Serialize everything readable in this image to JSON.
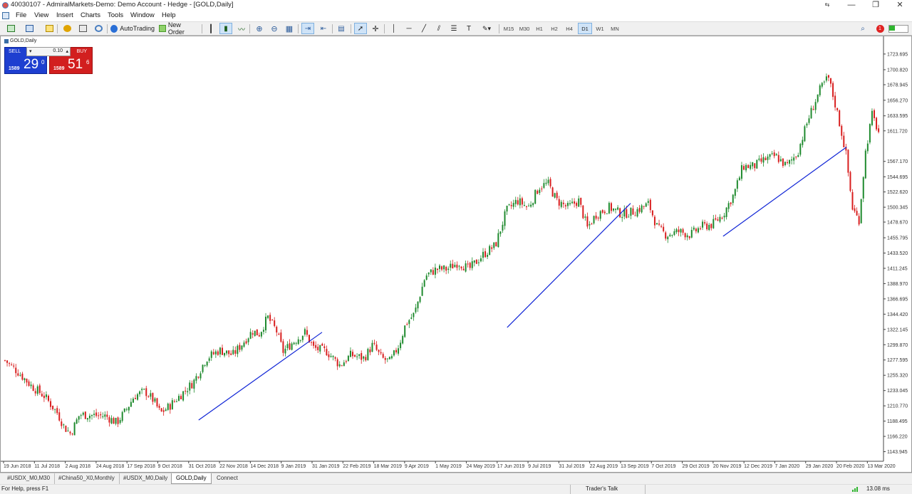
{
  "window": {
    "title": "40030107 - AdmiralMarkets-Demo: Demo Account - Hedge - [GOLD,Daily]"
  },
  "menu": [
    "File",
    "View",
    "Insert",
    "Charts",
    "Tools",
    "Window",
    "Help"
  ],
  "toolbar": {
    "autotrading_label": "AutoTrading",
    "neworder_label": "New Order",
    "timeframes": [
      "M15",
      "M30",
      "H1",
      "H2",
      "H4",
      "D1",
      "W1",
      "MN"
    ],
    "active_timeframe": "D1",
    "notification_count": "1"
  },
  "chart": {
    "symbol_label": "GOLD,Daily",
    "trade_panel": {
      "sell_label": "SELL",
      "buy_label": "BUY",
      "lot": "0.10",
      "sell_prefix": "1589",
      "sell_main": "29",
      "sell_sup": "0",
      "buy_prefix": "1589",
      "buy_main": "51",
      "buy_sup": "6"
    }
  },
  "chart_data": {
    "type": "candlestick",
    "symbol": "GOLD",
    "timeframe": "Daily",
    "price_labels": [
      "1723.695",
      "1700.820",
      "1678.945",
      "1656.270",
      "1633.595",
      "1611.720",
      "1567.170",
      "1544.695",
      "1522.620",
      "1500.345",
      "1478.670",
      "1455.795",
      "1433.520",
      "1411.245",
      "1388.970",
      "1366.695",
      "1344.420",
      "1322.145",
      "1299.870",
      "1277.595",
      "1255.320",
      "1233.045",
      "1210.770",
      "1188.495",
      "1166.220",
      "1143.945"
    ],
    "ylim": [
      1131,
      1735
    ],
    "date_labels": [
      "19 Jun 2018",
      "11 Jul 2018",
      "2 Aug 2018",
      "24 Aug 2018",
      "17 Sep 2018",
      "9 Oct 2018",
      "31 Oct 2018",
      "22 Nov 2018",
      "14 Dec 2018",
      "9 Jan 2019",
      "31 Jan 2019",
      "22 Feb 2019",
      "18 Mar 2019",
      "9 Apr 2019",
      "1 May 2019",
      "24 May 2019",
      "17 Jun 2019",
      "9 Jul 2019",
      "31 Jul 2019",
      "22 Aug 2019",
      "13 Sep 2019",
      "7 Oct 2019",
      "29 Oct 2019",
      "20 Nov 2019",
      "12 Dec 2019",
      "7 Jan 2020",
      "29 Jan 2020",
      "20 Feb 2020",
      "13 Mar 2020"
    ],
    "close_path": [
      [
        0,
        1277
      ],
      [
        6,
        1260
      ],
      [
        12,
        1240
      ],
      [
        18,
        1225
      ],
      [
        24,
        1200
      ],
      [
        27,
        1180
      ],
      [
        30,
        1170
      ],
      [
        34,
        1198
      ],
      [
        40,
        1197
      ],
      [
        46,
        1196
      ],
      [
        51,
        1186
      ],
      [
        55,
        1203
      ],
      [
        59,
        1225
      ],
      [
        64,
        1232
      ],
      [
        68,
        1218
      ],
      [
        71,
        1200
      ],
      [
        75,
        1210
      ],
      [
        80,
        1226
      ],
      [
        86,
        1245
      ],
      [
        92,
        1280
      ],
      [
        98,
        1292
      ],
      [
        104,
        1285
      ],
      [
        108,
        1300
      ],
      [
        113,
        1320
      ],
      [
        116,
        1315
      ],
      [
        120,
        1340
      ],
      [
        124,
        1320
      ],
      [
        127,
        1290
      ],
      [
        131,
        1302
      ],
      [
        137,
        1318
      ],
      [
        141,
        1295
      ],
      [
        147,
        1290
      ],
      [
        153,
        1270
      ],
      [
        158,
        1285
      ],
      [
        164,
        1280
      ],
      [
        168,
        1300
      ],
      [
        172,
        1280
      ],
      [
        176,
        1275
      ],
      [
        180,
        1300
      ],
      [
        183,
        1330
      ],
      [
        187,
        1345
      ],
      [
        192,
        1400
      ],
      [
        197,
        1410
      ],
      [
        202,
        1410
      ],
      [
        207,
        1420
      ],
      [
        212,
        1410
      ],
      [
        218,
        1430
      ],
      [
        224,
        1445
      ],
      [
        229,
        1495
      ],
      [
        234,
        1510
      ],
      [
        239,
        1500
      ],
      [
        244,
        1530
      ],
      [
        248,
        1535
      ],
      [
        252,
        1510
      ],
      [
        257,
        1500
      ],
      [
        262,
        1510
      ],
      [
        266,
        1470
      ],
      [
        270,
        1490
      ],
      [
        276,
        1500
      ],
      [
        282,
        1490
      ],
      [
        288,
        1495
      ],
      [
        294,
        1505
      ],
      [
        298,
        1470
      ],
      [
        302,
        1460
      ],
      [
        308,
        1465
      ],
      [
        313,
        1460
      ],
      [
        318,
        1472
      ],
      [
        323,
        1475
      ],
      [
        328,
        1490
      ],
      [
        333,
        1520
      ],
      [
        337,
        1560
      ],
      [
        342,
        1560
      ],
      [
        347,
        1570
      ],
      [
        352,
        1575
      ],
      [
        357,
        1560
      ],
      [
        362,
        1580
      ],
      [
        367,
        1630
      ],
      [
        372,
        1670
      ],
      [
        376,
        1690
      ],
      [
        380,
        1640
      ],
      [
        384,
        1580
      ],
      [
        387,
        1500
      ],
      [
        390,
        1480
      ],
      [
        393,
        1580
      ],
      [
        396,
        1635
      ],
      [
        399,
        1610
      ]
    ],
    "trendlines": [
      {
        "x1_label": "31 Oct 2018",
        "y1": 1190,
        "x2_label": "31 Jan 2019",
        "y2": 1318
      },
      {
        "x1_label": "17 Jun 2019",
        "y1": 1325,
        "x2_label": "13 Sep 2019",
        "y2": 1506
      },
      {
        "x1_label": "20 Nov 2019",
        "y1": 1458,
        "x2_label": "20 Feb 2020",
        "y2": 1588
      }
    ],
    "colors": {
      "up": "#1f8a2e",
      "down": "#d81e1e",
      "trendline": "#1025d6",
      "grid": "none"
    },
    "grid": false
  },
  "tabs": [
    "#USDX_M0,M30",
    "#China50_X0,Monthly",
    "#USDX_M0,Daily",
    "GOLD,Daily",
    "Connect"
  ],
  "active_tab": "GOLD,Daily",
  "status": {
    "help": "For Help, press F1",
    "traders_talk": "Trader's Talk",
    "traffic": "13.08 ms"
  }
}
